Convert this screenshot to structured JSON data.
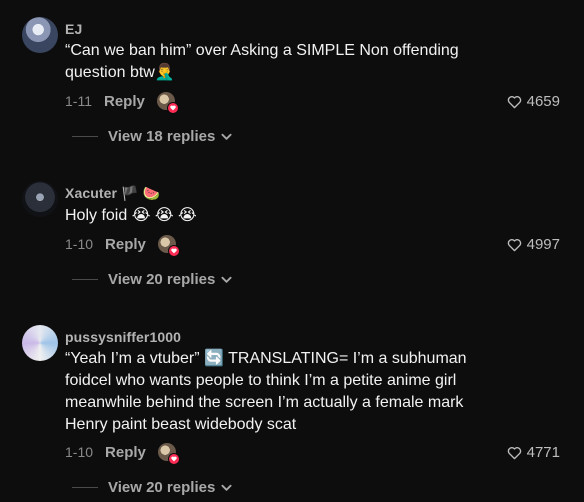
{
  "comments": [
    {
      "username": "EJ",
      "username_suffix": "",
      "text": "“Can we ban him” over Asking a SIMPLE Non offending question btw🤦‍♂️",
      "date": "1-11",
      "reply_label": "Reply",
      "likes": "4659",
      "view_replies": "View 18 replies",
      "avatar_color": "#6b7a99"
    },
    {
      "username": "Xacuter",
      "username_suffix": "🏴 🍉",
      "text": "Holy foid 😭 😭 😭",
      "date": "1-10",
      "reply_label": "Reply",
      "likes": "4997",
      "view_replies": "View 20 replies",
      "avatar_color": "#2a2f3a"
    },
    {
      "username": "pussysniffer1000",
      "username_suffix": "",
      "text": "“Yeah I’m a vtuber” 🔄 TRANSLATING= I’m a subhuman foidcel who wants people to think I’m a petite anime girl meanwhile behind the screen I’m actually a female mark Henry paint beast widebody scat",
      "date": "1-10",
      "reply_label": "Reply",
      "likes": "4771",
      "view_replies": "View 20 replies",
      "avatar_color": "#cfd6e6"
    }
  ],
  "colors": {
    "background": "#0d0d0d",
    "like_heart": "#bdbdbd",
    "badge": "#fe2c55"
  },
  "icons": {
    "like": "heart-outline-icon",
    "expand": "chevron-down-icon",
    "liked_by_creator": "creator-avatar-heart-icon"
  }
}
